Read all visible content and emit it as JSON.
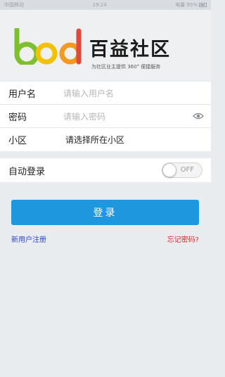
{
  "status_bar": {
    "left": "中国移动",
    "time": "19:24",
    "right": "电量 95%"
  },
  "brand": {
    "logo_text": "bod",
    "name": "百益社区",
    "slogan": "为社区业主提供 360° 便捷服务",
    "colors": {
      "green": "#7dbf2c",
      "yellow": "#f2c200",
      "red": "#e2483d",
      "orange": "#f39a1e"
    }
  },
  "form": {
    "username": {
      "label": "用户名",
      "placeholder": "请输入用户名"
    },
    "password": {
      "label": "密码",
      "placeholder": "请输入密码",
      "icon": "eye-icon"
    },
    "community": {
      "label": "小区",
      "value": "请选择所在小区"
    }
  },
  "auto_login": {
    "label": "自动登录",
    "toggle_text": "OFF",
    "enabled": false
  },
  "login_button": {
    "label": "登录",
    "color": "#1f97df"
  },
  "links": {
    "register": "新用户注册",
    "forgot": "忘记密码?"
  }
}
